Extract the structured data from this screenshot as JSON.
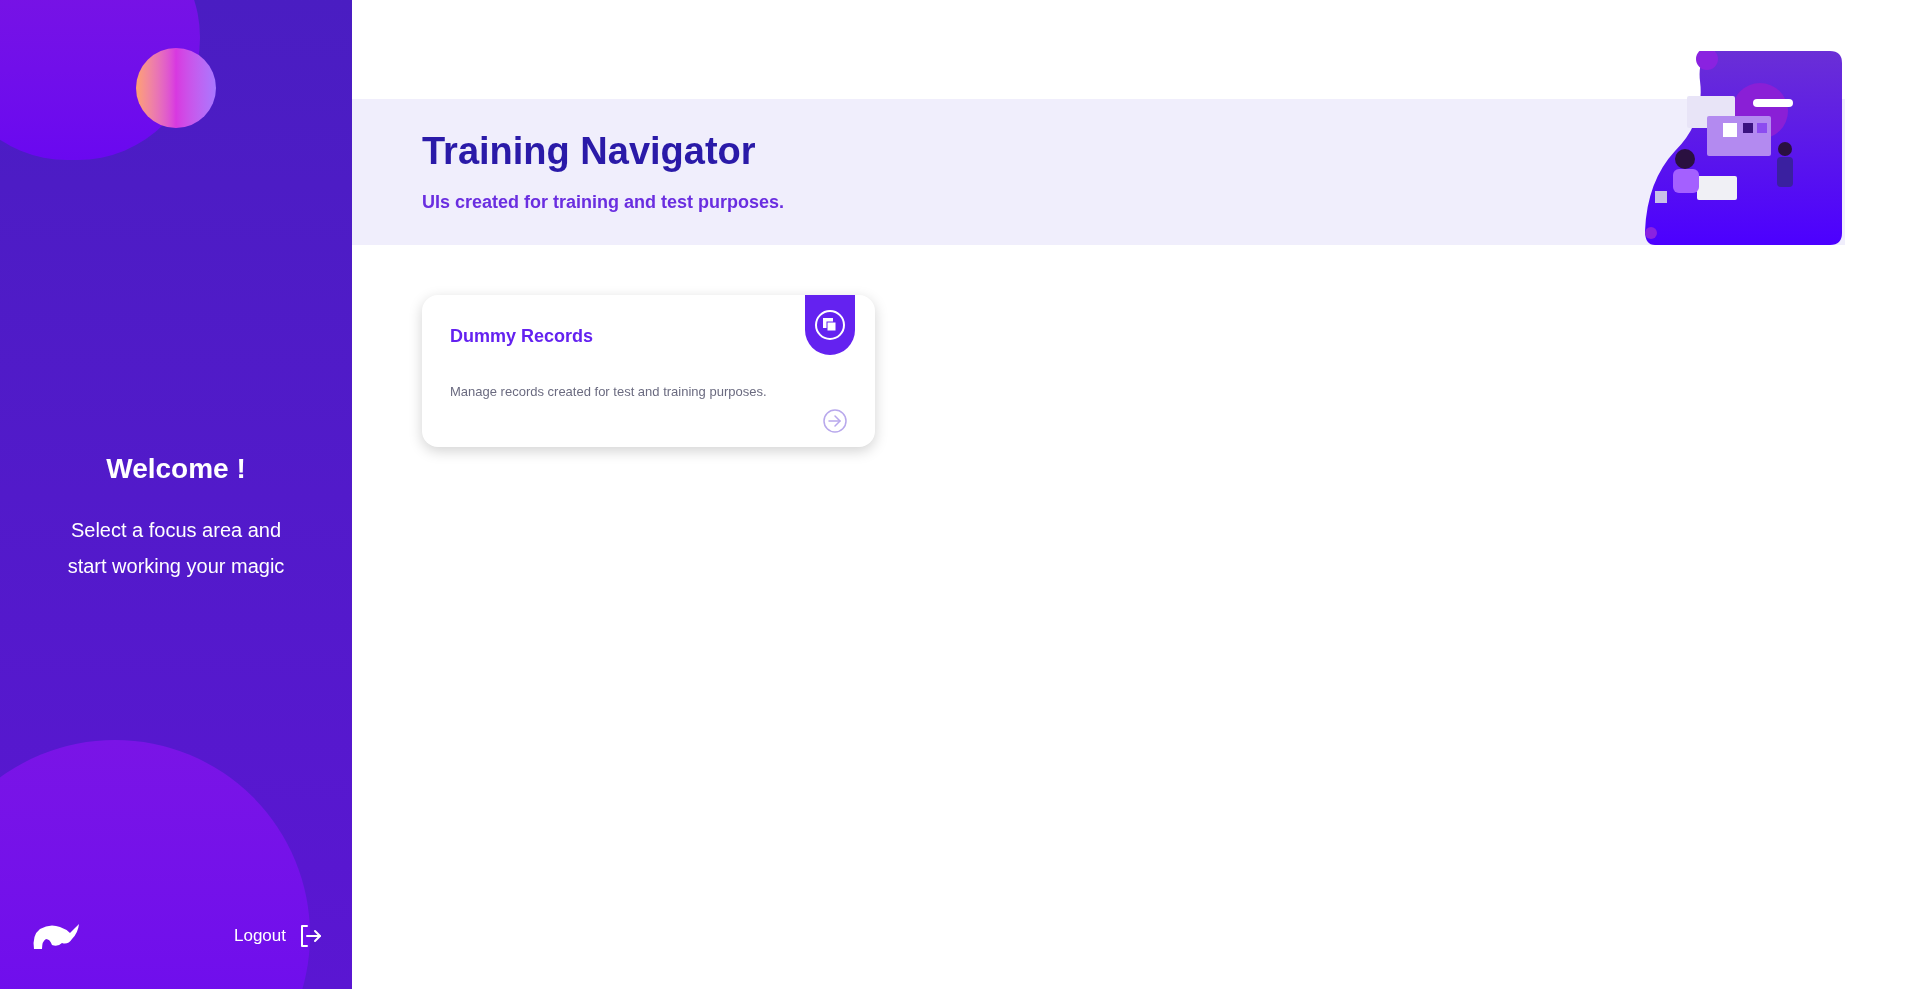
{
  "sidebar": {
    "welcome": "Welcome !",
    "message": "Select a focus area and start working your magic",
    "logout": "Logout"
  },
  "header": {
    "title": "Training Navigator",
    "subtitle": "UIs created for training and test purposes."
  },
  "cards": [
    {
      "title": "Dummy Records",
      "description": "Manage records created for test and training purposes."
    }
  ]
}
